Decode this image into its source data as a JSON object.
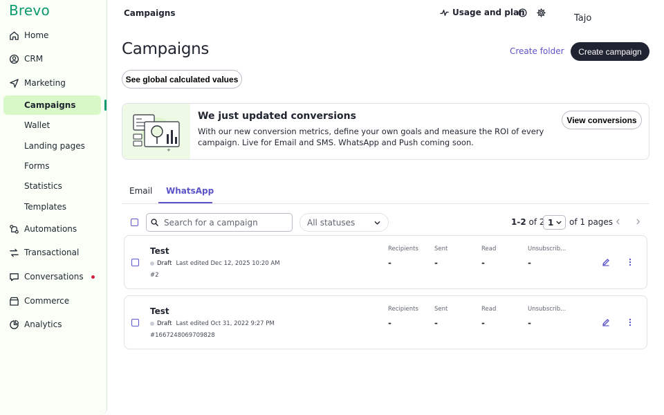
{
  "brand": "Brevo",
  "sidebar": {
    "items": [
      {
        "label": "Home",
        "icon": "home-icon"
      },
      {
        "label": "CRM",
        "icon": "contacts-icon"
      },
      {
        "label": "Marketing",
        "icon": "send-icon"
      },
      {
        "label": "Campaigns"
      },
      {
        "label": "Wallet"
      },
      {
        "label": "Landing pages"
      },
      {
        "label": "Forms"
      },
      {
        "label": "Statistics"
      },
      {
        "label": "Templates"
      },
      {
        "label": "Automations",
        "icon": "automation-icon"
      },
      {
        "label": "Transactional",
        "icon": "transactional-icon"
      },
      {
        "label": "Conversations",
        "icon": "chat-icon"
      },
      {
        "label": "Commerce",
        "icon": "commerce-icon"
      },
      {
        "label": "Analytics",
        "icon": "analytics-icon"
      }
    ]
  },
  "header": {
    "title": "Campaigns",
    "usage_label": "Usage and plan",
    "user": "Tajo"
  },
  "main": {
    "title": "Campaigns",
    "create_folder": "Create folder",
    "create_campaign": "Create campaign",
    "global_values": "See global calculated values"
  },
  "banner": {
    "title": "We just updated conversions",
    "text": "With our new conversion metrics, define your own goals and measure the ROI of every campaign. Live for Email and SMS. WhatsApp and Push coming soon.",
    "button": "View conversions"
  },
  "tabs": [
    {
      "label": "Email"
    },
    {
      "label": "WhatsApp",
      "active": true
    }
  ],
  "toolbar": {
    "search_placeholder": "Search for a campaign",
    "status_value": "All statuses",
    "range": "1-2",
    "of_word": "of",
    "total": "2",
    "page": "1",
    "pages_text": "of 1 pages"
  },
  "stat_headers": [
    "Recipients",
    "Sent",
    "Read",
    "Unsubscrib..."
  ],
  "campaigns": [
    {
      "name": "Test",
      "status": "Draft",
      "edited": "Last edited Dec 12, 2025 10:20 AM",
      "id": "#2",
      "stats": [
        "-",
        "-",
        "-",
        "-"
      ]
    },
    {
      "name": "Test",
      "status": "Draft",
      "edited": "Last edited Oct 31, 2022 9:27 PM",
      "id": "#1667248069709828",
      "stats": [
        "-",
        "-",
        "-",
        "-"
      ]
    }
  ],
  "colors": {
    "brand": "#0b996e",
    "accent": "#5b54c9",
    "sidebar_active": "#d9f8c8",
    "notification": "#d3203f"
  }
}
